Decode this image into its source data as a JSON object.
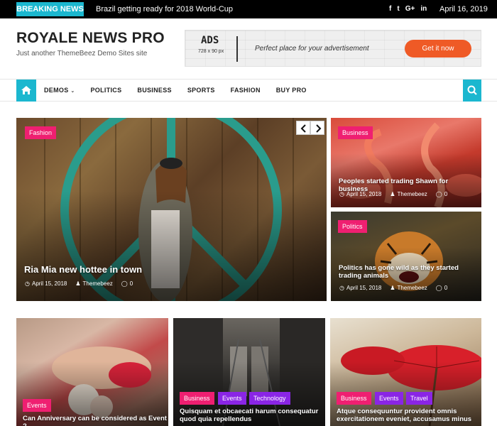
{
  "topbar": {
    "breaking_label": "BREAKING NEWS",
    "ticker_text": "Brazil getting ready for 2018 World-Cup",
    "socials": [
      "f",
      "t",
      "G+",
      "in"
    ],
    "date": "April 16, 2019"
  },
  "site": {
    "title": "ROYALE NEWS PRO",
    "description": "Just another ThemeBeez Demo Sites site"
  },
  "ad": {
    "title": "ADS",
    "size": "728 x 90 px",
    "text": "Perfect place for your advertisement",
    "button": "Get it now"
  },
  "nav": {
    "items": [
      "DEMOS",
      "POLITICS",
      "BUSINESS",
      "SPORTS",
      "FASHION",
      "BUY PRO"
    ]
  },
  "featured": {
    "main": {
      "category": "Fashion",
      "title": "Ria Mia new hottee in town",
      "date": "April 15, 2018",
      "author": "Themebeez",
      "comments": "0"
    },
    "side1": {
      "category": "Business",
      "title": "Peoples started trading Shawn for business",
      "date": "April 15, 2018",
      "author": "Themebeez",
      "comments": "0"
    },
    "side2": {
      "category": "Politics",
      "title": "Politics has gone wild as they started trading animals",
      "date": "April 15, 2018",
      "author": "Themebeez",
      "comments": "0"
    }
  },
  "cards": [
    {
      "categories": [
        "Events"
      ],
      "title": "Can Anniversary can be considered as Event ?"
    },
    {
      "categories": [
        "Business",
        "Events",
        "Technology"
      ],
      "title": "Quisquam et obcaecati harum consequatur quod quia repellendus"
    },
    {
      "categories": [
        "Business",
        "Events",
        "Travel"
      ],
      "title": "Atque consequuntur provident omnis exercitationem eveniet, accusamus minus"
    }
  ],
  "colors": {
    "accent": "#1bb7cf",
    "category": "#ef1f71",
    "category_alt": "#8a25e5",
    "ad_button": "#ef5a26"
  }
}
